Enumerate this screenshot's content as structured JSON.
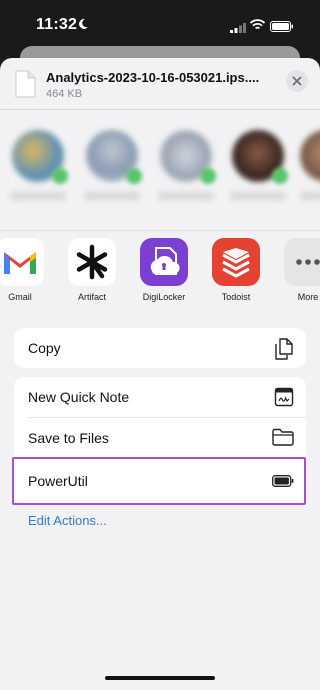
{
  "status_bar": {
    "time": "11:32",
    "icons": [
      "moon-icon",
      "signal-icon",
      "wifi-icon",
      "battery-icon"
    ]
  },
  "share_sheet": {
    "file": {
      "name": "Analytics-2023-10-16-053021.ips....",
      "size": "464 KB",
      "icon": "document-icon"
    },
    "close_icon": "close-icon",
    "apps": [
      {
        "label": "Gmail",
        "icon": "gmail-icon"
      },
      {
        "label": "Artifact",
        "icon": "artifact-icon"
      },
      {
        "label": "DigiLocker",
        "icon": "digilocker-icon"
      },
      {
        "label": "Todoist",
        "icon": "todoist-icon"
      },
      {
        "label": "More",
        "icon": "more-icon"
      }
    ],
    "actions_group_1": [
      {
        "label": "Copy",
        "icon": "copy-icon"
      }
    ],
    "actions_group_2": [
      {
        "label": "New Quick Note",
        "icon": "quick-note-icon"
      },
      {
        "label": "Save to Files",
        "icon": "folder-icon"
      },
      {
        "label": "PowerUtil",
        "icon": "battery-icon"
      }
    ],
    "edit_actions_label": "Edit Actions...",
    "colors": {
      "highlight": "#a052d6",
      "link": "#2f7bd9",
      "sheet_bg": "#f2f2f4"
    }
  }
}
